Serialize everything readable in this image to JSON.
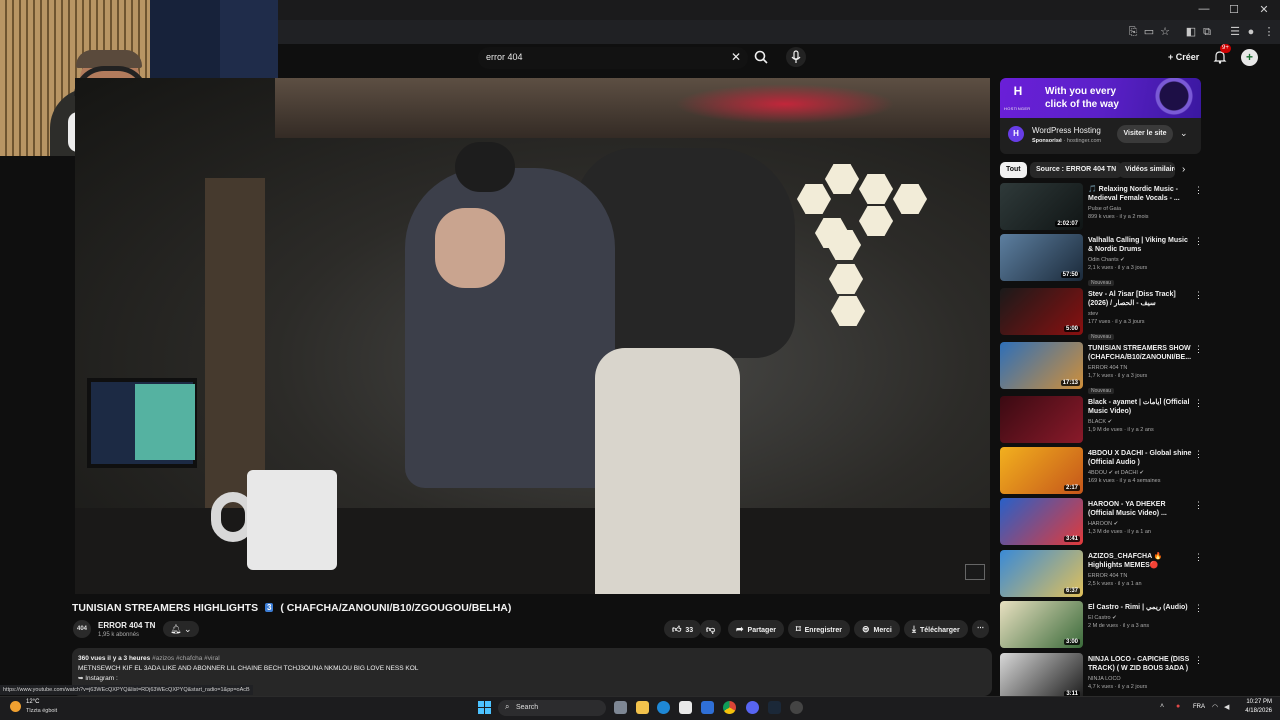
{
  "search": {
    "query": "error 404"
  },
  "header": {
    "create_label": "Créer",
    "notif_badge": "9+",
    "avatar_letter": "+"
  },
  "video": {
    "title_prefix": "TUNISIAN STREAMERS HIGHLIGHTS",
    "title_badge": "3",
    "title_suffix": "( CHAFCHA/ZANOUNI/B10/ZGOUGOU/BELHA)",
    "channel_avatar": "404",
    "channel_name": "ERROR 404 TN",
    "channel_subs": "1,95 k abonnés",
    "likes": "33",
    "share_label": "Partager",
    "save_label": "Enregistrer",
    "thanks_label": "Merci",
    "download_label": "Télécharger"
  },
  "description": {
    "views": "360 vues",
    "age": "il y a 3 heures",
    "tags": "#azizos #chafcha #viral",
    "line1": "METNSEWCH KIF EL 3ADA LIKE AND ABONNER LIL CHAINE BECH TCHJ3OUNA NKMLOU BIG LOVE NESS KOL",
    "line2": "➥ Instagram :"
  },
  "ad": {
    "brand": "H",
    "brand_label": "HOSTINGER",
    "headline": "With you every click of the way",
    "title": "WordPress Hosting",
    "sponsored": "Sponsorisé",
    "domain": "· hostinger.com",
    "cta": "Visiter le site"
  },
  "chips": [
    "Tout",
    "Source : ERROR 404 TN",
    "Vidéos similaires"
  ],
  "recommendations": [
    {
      "title": "🎵 Relaxing Nordic Music - Medieval Female Vocals - ...",
      "channel": "Pulse of Gaia",
      "meta": "899 k vues · il y a 2 mois",
      "duration": "2:02:07",
      "badge": ""
    },
    {
      "title": "Valhalla Calling | Viking Music & Nordic Drums",
      "channel": "Odin Chants ✔",
      "meta": "2,1 k vues · il y a 3 jours",
      "duration": "57:50",
      "badge": "Nouveau"
    },
    {
      "title": "Stev - Al 7isar [Diss Track] (2026) / سيف - الحصار",
      "channel": "stev",
      "meta": "177 vues · il y a 3 jours",
      "duration": "5:00",
      "badge": "Nouveau"
    },
    {
      "title": "TUNISIAN STREAMERS SHOW (CHAFCHA/B10/ZANOUNI/BE...",
      "channel": "ERROR 404 TN",
      "meta": "1,7 k vues · il y a 3 jours",
      "duration": "17:13",
      "badge": "Nouveau"
    },
    {
      "title": "Black - ayamet | أيامات (Official Music Video)",
      "channel": "BLACK ✔",
      "meta": "1,9 M de vues · il y a 2 ans",
      "duration": "",
      "badge": ""
    },
    {
      "title": "4BDOU X DACHI - Global shine (Official Audio )",
      "channel": "4BDOU ✔ et DACHI ✔",
      "meta": "169 k vues · il y a 4 semaines",
      "duration": "2:17",
      "badge": ""
    },
    {
      "title": "HAROON - YA DHEKER (Official Music Video) ...",
      "channel": "HAROON ✔",
      "meta": "1,3 M de vues · il y a 1 an",
      "duration": "3:41",
      "badge": ""
    },
    {
      "title": "AZIZOS_CHAFCHA 🔥 Highlights MEMES🔴",
      "channel": "ERROR 404 TN",
      "meta": "2,5 k vues · il y a 1 an",
      "duration": "6:37",
      "badge": ""
    },
    {
      "title": "El Castro - Rimi | ريمي (Audio)",
      "channel": "El Castro ✔",
      "meta": "2 M de vues · il y a 3 ans",
      "duration": "3:00",
      "badge": ""
    },
    {
      "title": "NINJA LOCO - CAPICHE (DISS TRACK) ( W ZID BOUS 3ADA )",
      "channel": "NINJA LOCO",
      "meta": "4,7 k vues · il y a 2 jours",
      "duration": "3:11",
      "badge": ""
    }
  ],
  "status_url": "https://www.youtube.com/watch?v=j63WEcQXPYQ&list=RDj63WEcQXPYQ&start_radio=1&pp=oAcB",
  "taskbar": {
    "temp": "12°C",
    "weather": "Tlzzta égboit",
    "search_placeholder": "Search",
    "lang": "FRA",
    "time": "10:27 PM",
    "date": "4/18/2026"
  },
  "colors": {
    "background": "#0f0f0f",
    "pill": "#272727",
    "ad_purple": "#673de6",
    "red": "#cc0000"
  }
}
